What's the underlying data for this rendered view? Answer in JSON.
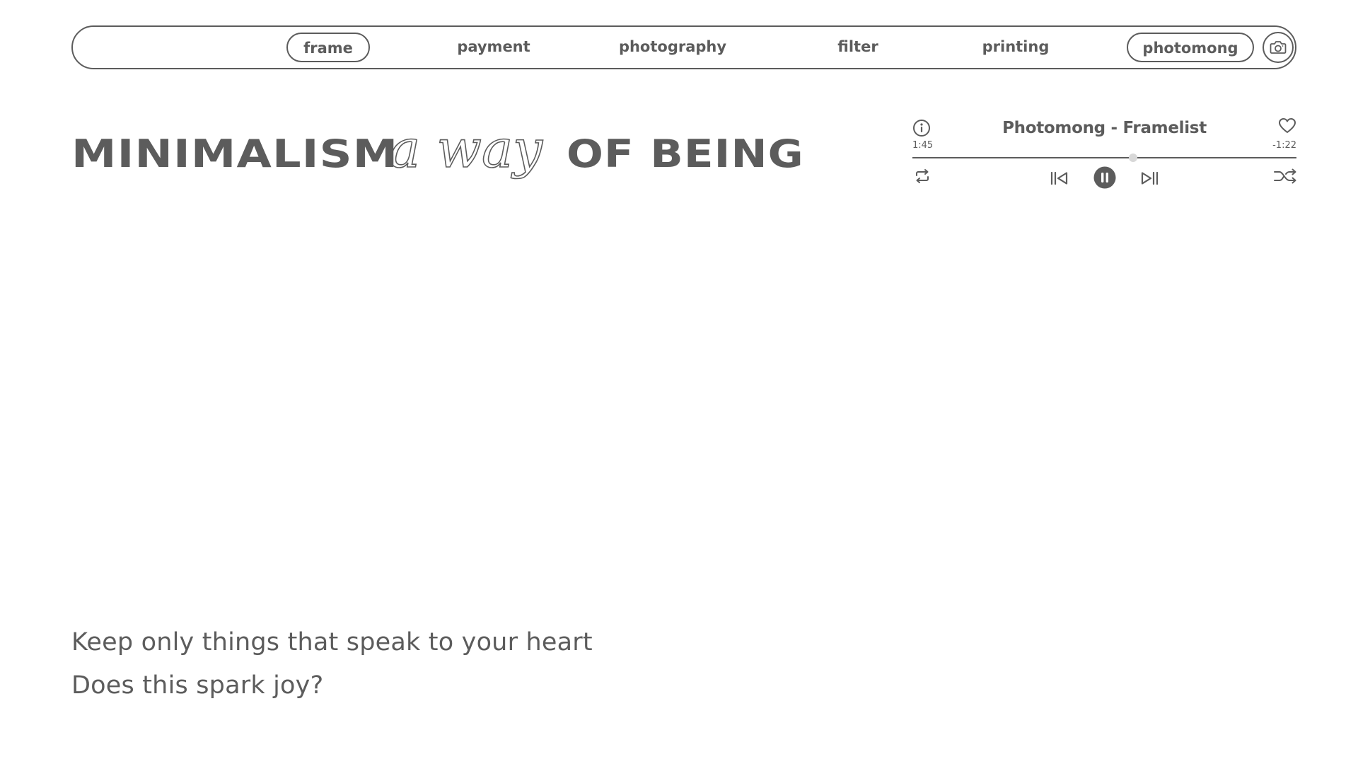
{
  "nav": {
    "items": [
      {
        "label": "frame",
        "outlined": true
      },
      {
        "label": "payment",
        "outlined": false
      },
      {
        "label": "photography",
        "outlined": false
      },
      {
        "label": "filter",
        "outlined": false
      },
      {
        "label": "printing",
        "outlined": false
      },
      {
        "label": "photomong",
        "outlined": true
      }
    ],
    "camera_icon": "camera-icon"
  },
  "headline": {
    "part1": "MINIMALISM",
    "script": "a way",
    "part2": "OF BEING"
  },
  "player": {
    "title": "Photomong - Framelist",
    "elapsed": "1:45",
    "remaining": "-1:22",
    "progress": 0.575,
    "icons": {
      "info": "info-icon",
      "favorite": "heart-icon",
      "repeat": "repeat-icon",
      "previous": "skip-previous-icon",
      "pause": "pause-icon",
      "next": "skip-next-icon",
      "shuffle": "shuffle-icon"
    }
  },
  "quote": {
    "line1": "Keep only things that speak to your heart",
    "line2": "Does this spark joy?"
  },
  "colors": {
    "text": "#5c5c5c",
    "background": "#ffffff",
    "thumb": "#d8d8d8"
  }
}
